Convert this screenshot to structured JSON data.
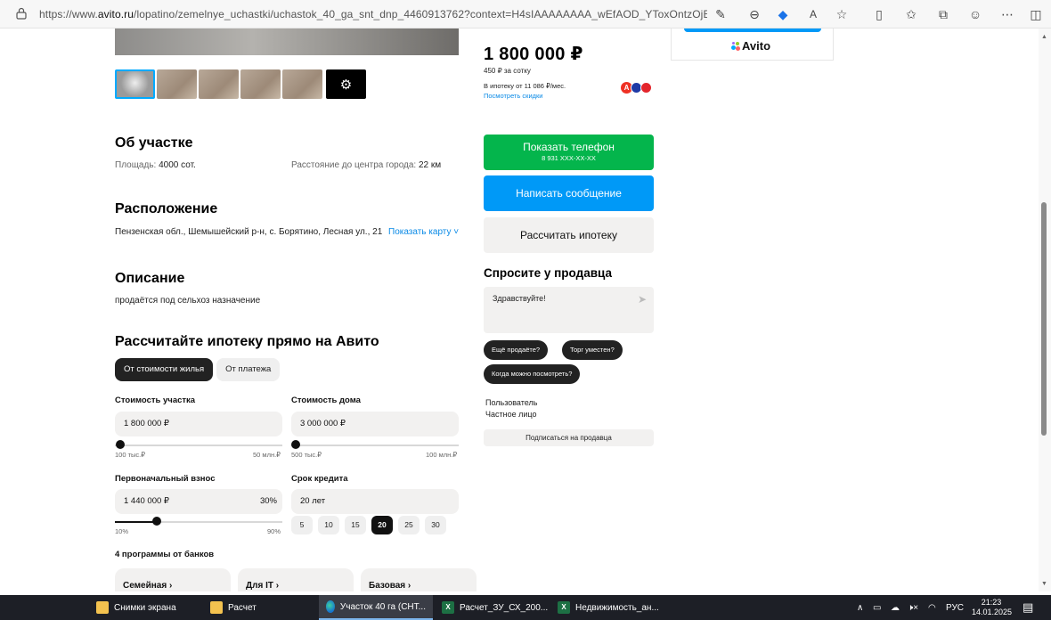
{
  "browser": {
    "url_prefix": "https://www.",
    "url_host": "avito.ru",
    "url_path": "/lopatino/zemelnye_uchastki/uchastok_40_ga_snt_dnp_4460913762?context=H4sIAAAAAAAA_wEfAOD_YToxOntzOjEzOiJsb2Nh...",
    "toolbar_icons": [
      "read-aloud-icon",
      "zoom-icon",
      "shield-icon",
      "font-icon",
      "favorite-icon",
      "split-icon",
      "favorites-list-icon",
      "collections-icon",
      "profile-icon",
      "more-icon",
      "sidebar-icon"
    ]
  },
  "listing": {
    "price": "1 800 000 ₽",
    "price_per_unit": "450 ₽ за сотку",
    "mortgage_from": "В ипотеку от 11 086 ₽/мес.",
    "discounts_link": "Посмотреть скидки"
  },
  "about": {
    "title": "Об участке",
    "area_label": "Площадь:",
    "area_value": "4000 сот.",
    "distance_label": "Расстояние до центра города:",
    "distance_value": "22 км"
  },
  "location": {
    "title": "Расположение",
    "address": "Пензенская обл., Шемышейский р-н, с. Борятино, Лесная ул., 21",
    "show_map": "Показать карту"
  },
  "description": {
    "title": "Описание",
    "text": "продаётся под сельхоз назначение"
  },
  "mortgage_calc": {
    "title": "Рассчитайте ипотеку прямо на Авито",
    "tabs": [
      "От стоимости жилья",
      "От платежа"
    ],
    "plot_cost": {
      "label": "Стоимость участка",
      "value": "1 800 000 ₽",
      "min": "100 тыс.₽",
      "max": "50 млн.₽",
      "position": 0.034
    },
    "house_cost": {
      "label": "Стоимость дома",
      "value": "3 000 000 ₽",
      "min": "500 тыс.₽",
      "max": "100 млн.₽",
      "position": 0.025
    },
    "down_payment": {
      "label": "Первоначальный взнос",
      "value": "1 440 000 ₽",
      "percent": "30%",
      "min": "10%",
      "max": "90%",
      "position": 0.25
    },
    "term": {
      "label": "Срок кредита",
      "value": "20 лет",
      "options": [
        "5",
        "10",
        "15",
        "20",
        "25",
        "30"
      ],
      "selected": "20"
    },
    "banks_title": "4 программы от банков",
    "programs": [
      "Семейная ›",
      "Для IT ›",
      "Базовая ›"
    ]
  },
  "contact": {
    "show_phone": "Показать телефон",
    "phone_masked": "8 931 XXX-XX-XX",
    "write_message": "Написать сообщение",
    "calc_mortgage": "Рассчитать ипотеку"
  },
  "ask_seller": {
    "title": "Спросите у продавца",
    "message": "Здравствуйте!",
    "quick_questions": [
      "Ещё продаёте?",
      "Торг уместен?",
      "Когда можно посмотреть?"
    ]
  },
  "seller": {
    "name": "Пользователь",
    "type": "Частное лицо",
    "subscribe": "Подписаться на продавца"
  },
  "ad": {
    "brand": "Avito"
  },
  "taskbar": {
    "items": [
      {
        "label": "Снимки экрана",
        "icon": "folder-icon"
      },
      {
        "label": "Расчет",
        "icon": "folder-icon"
      },
      {
        "label": "Участок 40 га (СНТ...",
        "icon": "edge-icon"
      },
      {
        "label": "Расчет_ЗУ_СХ_200...",
        "icon": "excel-icon"
      },
      {
        "label": "Недвижимость_ан...",
        "icon": "excel-icon"
      }
    ],
    "language": "РУС",
    "time": "21:23",
    "date": "14.01.2025"
  },
  "colors": {
    "green": "#04b54c",
    "blue": "#0099f7",
    "link": "#0a8ae6",
    "chip_dark": "#222222"
  }
}
